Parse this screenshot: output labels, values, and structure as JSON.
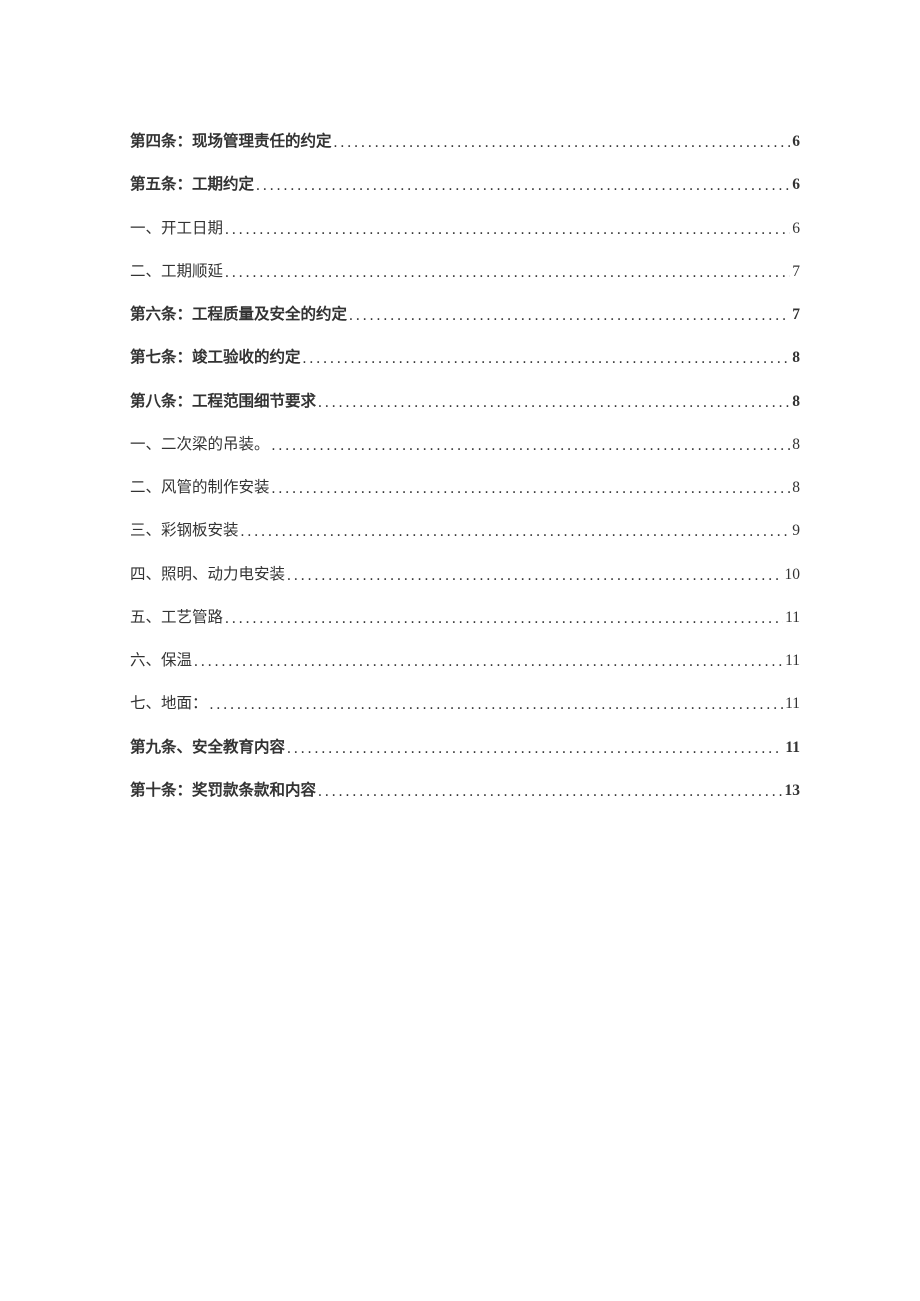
{
  "toc": [
    {
      "title": "第四条：现场管理责任的约定",
      "page": "6",
      "bold": true
    },
    {
      "title": "第五条：工期约定",
      "page": "6",
      "bold": true
    },
    {
      "title": "一、开工日期",
      "page": "6",
      "bold": false
    },
    {
      "title": "二、工期顺延",
      "page": "7",
      "bold": false
    },
    {
      "title": "第六条：工程质量及安全的约定",
      "page": "7",
      "bold": true
    },
    {
      "title": "第七条：竣工验收的约定",
      "page": "8",
      "bold": true
    },
    {
      "title": "第八条：工程范围细节要求",
      "page": "8",
      "bold": true
    },
    {
      "title": "一、二次梁的吊装。",
      "page": "8",
      "bold": false
    },
    {
      "title": "二、风管的制作安装",
      "page": "8",
      "bold": false
    },
    {
      "title": "三、彩钢板安装",
      "page": "9",
      "bold": false
    },
    {
      "title": "四、照明、动力电安装",
      "page": "10",
      "bold": false
    },
    {
      "title": "五、工艺管路",
      "page": "11",
      "bold": false
    },
    {
      "title": "六、保温",
      "page": "11",
      "bold": false
    },
    {
      "title": "七、地面：",
      "page": "11",
      "bold": false
    },
    {
      "title": "第九条、安全教育内容",
      "page": "11",
      "bold": true
    },
    {
      "title": "第十条：奖罚款条款和内容",
      "page": "13",
      "bold": true
    }
  ]
}
